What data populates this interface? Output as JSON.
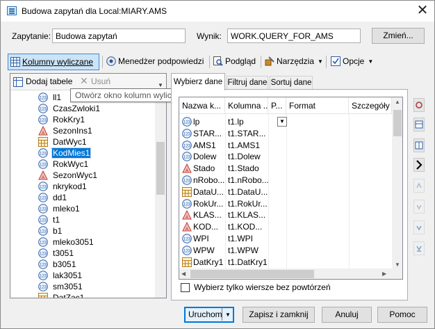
{
  "window": {
    "title": "Budowa zapytań dla Local:MIARY.AMS",
    "close_glyph": "✕"
  },
  "query": {
    "label": "Zapytanie:",
    "value": "Budowa zapytań",
    "result_label": "Wynik:",
    "result_value": "WORK.QUERY_FOR_AMS",
    "change_button": "Zmień..."
  },
  "toolbar": {
    "computed_columns": "Kolumny wyliczane",
    "prompt_manager": "Menedżer podpowiedzi",
    "preview": "Podgląd",
    "tools": "Narzędzia",
    "options": "Opcje"
  },
  "left_panel": {
    "add_tables": "Dodaj tabele",
    "remove": "Usuń",
    "items": [
      {
        "name": "ll1",
        "type": "numeric"
      },
      {
        "name": "CzasZwloki1",
        "type": "numeric"
      },
      {
        "name": "RokKry1",
        "type": "numeric"
      },
      {
        "name": "SezonIns1",
        "type": "char"
      },
      {
        "name": "DatWyc1",
        "type": "date"
      },
      {
        "name": "KodMies1",
        "type": "numeric",
        "selected": true
      },
      {
        "name": "RokWyc1",
        "type": "numeric"
      },
      {
        "name": "SezonWyc1",
        "type": "char"
      },
      {
        "name": "nkrykod1",
        "type": "numeric"
      },
      {
        "name": "dd1",
        "type": "numeric"
      },
      {
        "name": "mleko1",
        "type": "numeric"
      },
      {
        "name": "t1",
        "type": "numeric"
      },
      {
        "name": "b1",
        "type": "numeric"
      },
      {
        "name": "mleko3051",
        "type": "numeric"
      },
      {
        "name": "t3051",
        "type": "numeric"
      },
      {
        "name": "b3051",
        "type": "numeric"
      },
      {
        "name": "lak3051",
        "type": "numeric"
      },
      {
        "name": "sm3051",
        "type": "numeric"
      },
      {
        "name": "DatZac1",
        "type": "date"
      }
    ]
  },
  "tooltip": "Otwórz okno kolumn wyliczanych",
  "tabs": [
    "Wybierz dane",
    "Filtruj dane",
    "Sortuj dane"
  ],
  "grid": {
    "headers": [
      "Nazwa k...",
      "Kolumna ...",
      "P...",
      "Format",
      "Szczegóły"
    ],
    "rows": [
      {
        "name": "lp",
        "column": "t1.lp",
        "type": "numeric"
      },
      {
        "name": "STAR...",
        "column": "t1.STAR...",
        "type": "numeric"
      },
      {
        "name": "AMS1",
        "column": "t1.AMS1",
        "type": "numeric"
      },
      {
        "name": "Dolew",
        "column": "t1.Dolew",
        "type": "numeric"
      },
      {
        "name": "Stado",
        "column": "t1.Stado",
        "type": "char"
      },
      {
        "name": "nRobo...",
        "column": "t1.nRobo...",
        "type": "numeric"
      },
      {
        "name": "DataU...",
        "column": "t1.DataU...",
        "type": "date"
      },
      {
        "name": "RokUr...",
        "column": "t1.RokUr...",
        "type": "numeric"
      },
      {
        "name": "KLAS...",
        "column": "t1.KLAS...",
        "type": "char"
      },
      {
        "name": "KOD...",
        "column": "t1.KOD...",
        "type": "char"
      },
      {
        "name": "WPI",
        "column": "t1.WPI",
        "type": "numeric"
      },
      {
        "name": "WPW",
        "column": "t1.WPW",
        "type": "numeric"
      },
      {
        "name": "DatKry1",
        "column": "t1.DatKry1",
        "type": "date"
      }
    ]
  },
  "distinct_label": "Wybierz tylko wiersze bez powtórzeń",
  "buttons": {
    "run": "Uruchom",
    "save_close": "Zapisz i zamknij",
    "cancel": "Anuluj",
    "help": "Pomoc"
  }
}
